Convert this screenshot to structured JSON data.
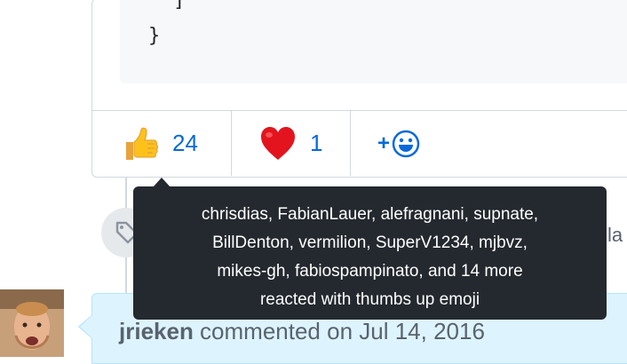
{
  "code": {
    "line1": "]",
    "line2": "}"
  },
  "reactions": [
    {
      "emoji": "thumbs-up-emoji",
      "count": "24"
    },
    {
      "emoji": "heart-emoji",
      "count": "1"
    }
  ],
  "add_reaction": {
    "plus": "+",
    "icon": "smiley-icon"
  },
  "tooltip": {
    "line1": "chrisdias, FabianLauer, alefragnani, supnate,",
    "line2": "BillDenton, vermilion, SuperV1234, mjbvz,",
    "line3": "mikes-gh, fabiospampinato, and 14 more",
    "line4": "reacted with thumbs up emoji"
  },
  "timeline": {
    "event_icon": "tag-icon",
    "partial_text": "la"
  },
  "comment": {
    "author": "jrieken",
    "action": " commented on Jul 14, 2016"
  },
  "colors": {
    "link": "#0969da",
    "tooltip_bg": "#24292f",
    "header_bg": "#ddf4ff"
  }
}
